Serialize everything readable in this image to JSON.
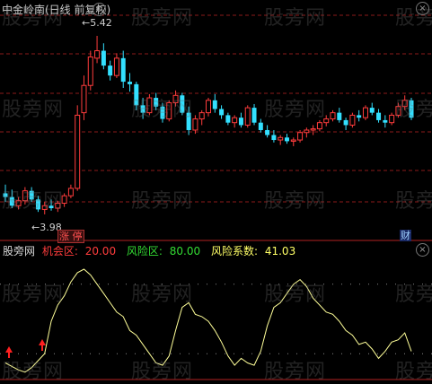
{
  "header": {
    "title": "中金岭南(日线 前复权)"
  },
  "price_labels": {
    "high": "5.42",
    "low": "3.98"
  },
  "badges": {
    "limit_up": "涨 停",
    "finance": "财"
  },
  "indicator": {
    "name": "股旁网",
    "opportunity_label": "机会区:",
    "opportunity_value": "20.00",
    "risk_zone_label": "风险区:",
    "risk_zone_value": "80.00",
    "risk_coef_label": "风险系数:",
    "risk_coef_value": "41.03"
  },
  "watermark": "股旁网",
  "colors": {
    "background": "#000000",
    "up": "#ff3c3c",
    "down": "#33e0ff",
    "indicator_line": "#ffff99",
    "grid": "#8b1a1a",
    "level_dots": "#8a8a8a"
  },
  "icons": {
    "close": "x-circle-icon",
    "indicator": "gear-circle-icon"
  },
  "chart_data": [
    {
      "type": "candlestick",
      "title": "中金岭南(日线 前复权)",
      "ylim": [
        3.9,
        5.55
      ],
      "annotations": [
        "5.42",
        "3.98"
      ],
      "candles": [
        [
          4.15,
          4.22,
          4.08,
          4.12
        ],
        [
          4.12,
          4.18,
          4.03,
          4.05
        ],
        [
          4.05,
          4.12,
          4.02,
          4.09
        ],
        [
          4.09,
          4.2,
          4.06,
          4.17
        ],
        [
          4.17,
          4.2,
          4.08,
          4.1
        ],
        [
          4.1,
          4.13,
          4.0,
          4.02
        ],
        [
          4.02,
          4.08,
          3.98,
          4.05
        ],
        [
          4.05,
          4.1,
          4.01,
          4.03
        ],
        [
          4.03,
          4.09,
          4.0,
          4.07
        ],
        [
          4.07,
          4.15,
          4.04,
          4.13
        ],
        [
          4.13,
          4.22,
          4.11,
          4.19
        ],
        [
          4.19,
          4.86,
          4.17,
          4.78
        ],
        [
          4.8,
          5.1,
          4.74,
          5.02
        ],
        [
          5.02,
          5.3,
          4.98,
          5.25
        ],
        [
          5.24,
          5.42,
          5.2,
          5.3
        ],
        [
          5.3,
          5.36,
          5.15,
          5.18
        ],
        [
          5.18,
          5.22,
          5.06,
          5.1
        ],
        [
          5.1,
          5.28,
          5.08,
          5.24
        ],
        [
          5.24,
          5.3,
          5.0,
          5.05
        ],
        [
          5.05,
          5.12,
          4.97,
          5.03
        ],
        [
          5.03,
          5.05,
          4.82,
          4.86
        ],
        [
          4.86,
          4.92,
          4.75,
          4.8
        ],
        [
          4.8,
          4.95,
          4.78,
          4.92
        ],
        [
          4.92,
          4.96,
          4.82,
          4.85
        ],
        [
          4.85,
          4.88,
          4.72,
          4.75
        ],
        [
          4.75,
          4.9,
          4.73,
          4.88
        ],
        [
          4.88,
          4.98,
          4.85,
          4.94
        ],
        [
          4.94,
          4.96,
          4.78,
          4.8
        ],
        [
          4.8,
          4.85,
          4.62,
          4.66
        ],
        [
          4.66,
          4.78,
          4.63,
          4.75
        ],
        [
          4.75,
          4.82,
          4.7,
          4.8
        ],
        [
          4.8,
          4.92,
          4.77,
          4.9
        ],
        [
          4.9,
          4.95,
          4.8,
          4.83
        ],
        [
          4.83,
          4.86,
          4.75,
          4.78
        ],
        [
          4.78,
          4.8,
          4.7,
          4.72
        ],
        [
          4.72,
          4.78,
          4.68,
          4.76
        ],
        [
          4.76,
          4.8,
          4.68,
          4.7
        ],
        [
          4.7,
          4.86,
          4.68,
          4.84
        ],
        [
          4.84,
          4.87,
          4.7,
          4.72
        ],
        [
          4.72,
          4.75,
          4.64,
          4.66
        ],
        [
          4.66,
          4.7,
          4.6,
          4.62
        ],
        [
          4.62,
          4.66,
          4.56,
          4.58
        ],
        [
          4.58,
          4.62,
          4.54,
          4.6
        ],
        [
          4.6,
          4.63,
          4.55,
          4.57
        ],
        [
          4.57,
          4.6,
          4.53,
          4.58
        ],
        [
          4.58,
          4.66,
          4.56,
          4.64
        ],
        [
          4.64,
          4.68,
          4.6,
          4.66
        ],
        [
          4.66,
          4.7,
          4.62,
          4.67
        ],
        [
          4.67,
          4.74,
          4.65,
          4.72
        ],
        [
          4.72,
          4.78,
          4.69,
          4.75
        ],
        [
          4.75,
          4.82,
          4.73,
          4.8
        ],
        [
          4.8,
          4.84,
          4.72,
          4.74
        ],
        [
          4.74,
          4.76,
          4.66,
          4.7
        ],
        [
          4.7,
          4.8,
          4.68,
          4.78
        ],
        [
          4.78,
          4.82,
          4.73,
          4.76
        ],
        [
          4.76,
          4.86,
          4.74,
          4.84
        ],
        [
          4.84,
          4.88,
          4.78,
          4.8
        ],
        [
          4.8,
          4.83,
          4.72,
          4.74
        ],
        [
          4.74,
          4.78,
          4.68,
          4.72
        ],
        [
          4.72,
          4.8,
          4.7,
          4.78
        ],
        [
          4.78,
          4.88,
          4.76,
          4.85
        ],
        [
          4.85,
          4.94,
          4.82,
          4.9
        ],
        [
          4.9,
          4.92,
          4.74,
          4.76
        ]
      ]
    },
    {
      "type": "line",
      "title": "股旁网",
      "ylim": [
        0,
        100
      ],
      "levels": [
        20,
        80
      ],
      "series": [
        {
          "values": [
            12,
            9,
            6,
            4,
            8,
            14,
            20,
            48,
            62,
            70,
            82,
            90,
            93,
            88,
            80,
            72,
            64,
            56,
            52,
            40,
            36,
            28,
            20,
            12,
            10,
            18,
            40,
            60,
            64,
            54,
            52,
            48,
            40,
            30,
            18,
            10,
            16,
            12,
            10,
            22,
            44,
            60,
            64,
            72,
            80,
            84,
            78,
            68,
            62,
            56,
            54,
            48,
            40,
            36,
            28,
            30,
            24,
            16,
            22,
            30,
            32,
            38,
            22
          ]
        }
      ]
    }
  ]
}
